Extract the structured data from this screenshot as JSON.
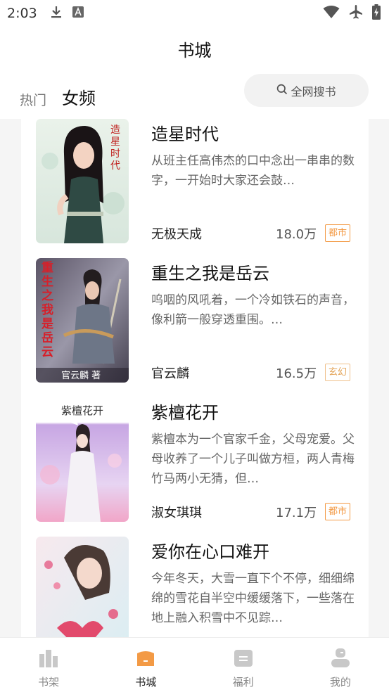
{
  "status_bar": {
    "time": "2:03"
  },
  "header": {
    "title": "书城"
  },
  "tabs": [
    {
      "label": "热门"
    },
    {
      "label": "女频"
    }
  ],
  "search": {
    "label": "全网搜书"
  },
  "books": [
    {
      "title": "造星时代",
      "desc": "从班主任高伟杰的口中念出一串串的数字，一开始时大家还会鼓…",
      "author": "无极天成",
      "count": "18.0万",
      "tag": "都市",
      "cover_text": "造星时代"
    },
    {
      "title": "重生之我是岳云",
      "desc": "呜咽的风吼着，一个冷如铁石的声音，像利箭一般穿透重围。…",
      "author": "官云麟",
      "count": "16.5万",
      "tag": "玄幻",
      "cover_text": "重生之我是岳云",
      "cover_sub": "官云麟 著"
    },
    {
      "title": "紫檀花开",
      "desc": "紫檀本为一个官家千金，父母宠爱。父母收养了一个儿子叫做方桓，两人青梅竹马两小无猜，但…",
      "author": "淑女琪琪",
      "count": "17.1万",
      "tag": "都市",
      "cover_text": "紫檀花开"
    },
    {
      "title": "爱你在心口难开",
      "desc": "今年冬天，大雪一直下个不停，细细绵绵的雪花自半空中缓缓落下，一些落在地上融入积雪中不见踪…"
    }
  ],
  "bottom_nav": [
    {
      "label": "书架"
    },
    {
      "label": "书城"
    },
    {
      "label": "福利"
    },
    {
      "label": "我的"
    }
  ],
  "colors": {
    "accent": "#f39a45",
    "nav_inactive": "#c8c8c8"
  }
}
